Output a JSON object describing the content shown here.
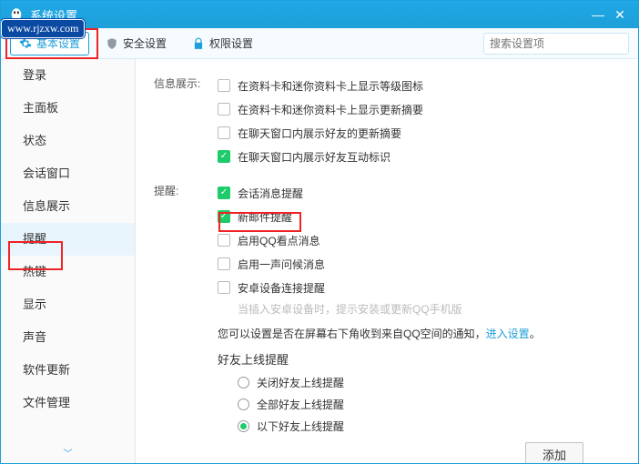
{
  "window": {
    "title": "系统设置"
  },
  "watermark": "www.rjzxw.com",
  "tabs": {
    "basic": "基本设置",
    "security": "安全设置",
    "permission": "权限设置"
  },
  "search": {
    "placeholder": "搜索设置项"
  },
  "sidebar": {
    "items": [
      "登录",
      "主面板",
      "状态",
      "会话窗口",
      "信息展示",
      "提醒",
      "热键",
      "显示",
      "声音",
      "软件更新",
      "文件管理"
    ]
  },
  "content": {
    "info_display_label": "信息展示:",
    "info_display": {
      "i0": {
        "checked": false,
        "label": "在资料卡和迷你资料卡上显示等级图标"
      },
      "i1": {
        "checked": false,
        "label": "在资料卡和迷你资料卡上显示更新摘要"
      },
      "i2": {
        "checked": false,
        "label": "在聊天窗口内展示好友的更新摘要"
      },
      "i3": {
        "checked": true,
        "label": "在聊天窗口内展示好友互动标识"
      }
    },
    "reminder_label": "提醒:",
    "reminder": {
      "r0": {
        "checked": true,
        "label": "会话消息提醒"
      },
      "r1": {
        "checked": true,
        "label": "新邮件提醒"
      },
      "r2": {
        "checked": false,
        "label": "启用QQ看点消息"
      },
      "r3": {
        "checked": false,
        "label": "启用一声问候消息"
      },
      "r4": {
        "checked": false,
        "label": "安卓设备连接提醒"
      },
      "r4_hint": "当插入安卓设备时，提示安装或更新QQ手机版",
      "qzone_text_a": "您可以设置是否在屏幕右下角收到来自QQ空间的通知，",
      "qzone_link": "进入设置",
      "qzone_period": "。",
      "online_head": "好友上线提醒",
      "online": {
        "o0": {
          "checked": false,
          "label": "关闭好友上线提醒"
        },
        "o1": {
          "checked": false,
          "label": "全部好友上线提醒"
        },
        "o2": {
          "checked": true,
          "label": "以下好友上线提醒"
        }
      },
      "add_btn": "添加"
    }
  }
}
